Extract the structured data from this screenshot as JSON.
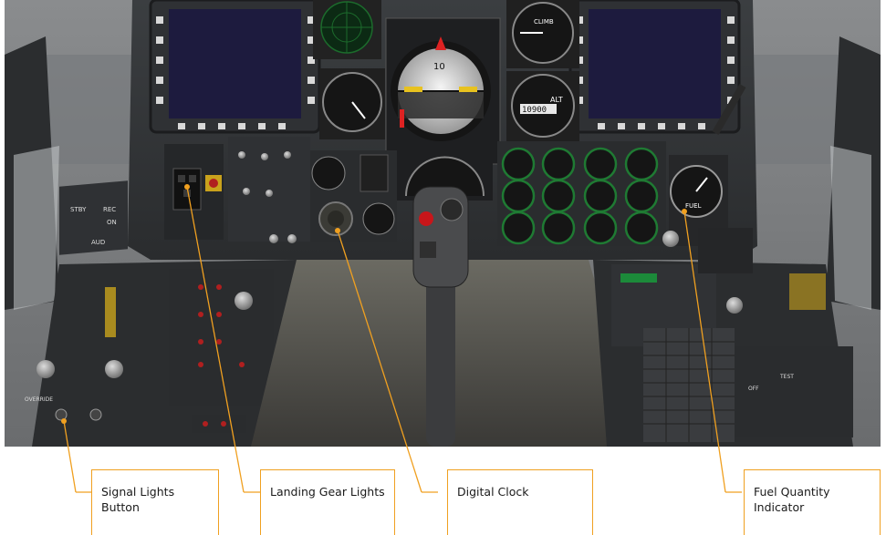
{
  "callouts": {
    "signal_lights": "Signal Lights Button",
    "landing_gear": "Landing Gear Lights",
    "digital_clock": "Digital Clock",
    "fuel_quantity": "Fuel Quantity Indicator"
  },
  "cockpit": {
    "climb": "CLIMB",
    "alt": "ALT",
    "alt_readout": "10900",
    "ind_hdg": "10",
    "stby": "STBY",
    "rec": "REC",
    "on": "ON",
    "aud": "AUD",
    "fuel": "FUEL",
    "override": "OVERRIDE",
    "test": "TEST",
    "off": "OFF"
  },
  "colors": {
    "callout_border": "#f0a020",
    "leader_line": "#f0a020",
    "mfd_screen": "#1d1b3e",
    "gauge_face": "#151515",
    "gauge_ring_green": "#1f7a33",
    "adi_sky": "#e6e6e6"
  }
}
